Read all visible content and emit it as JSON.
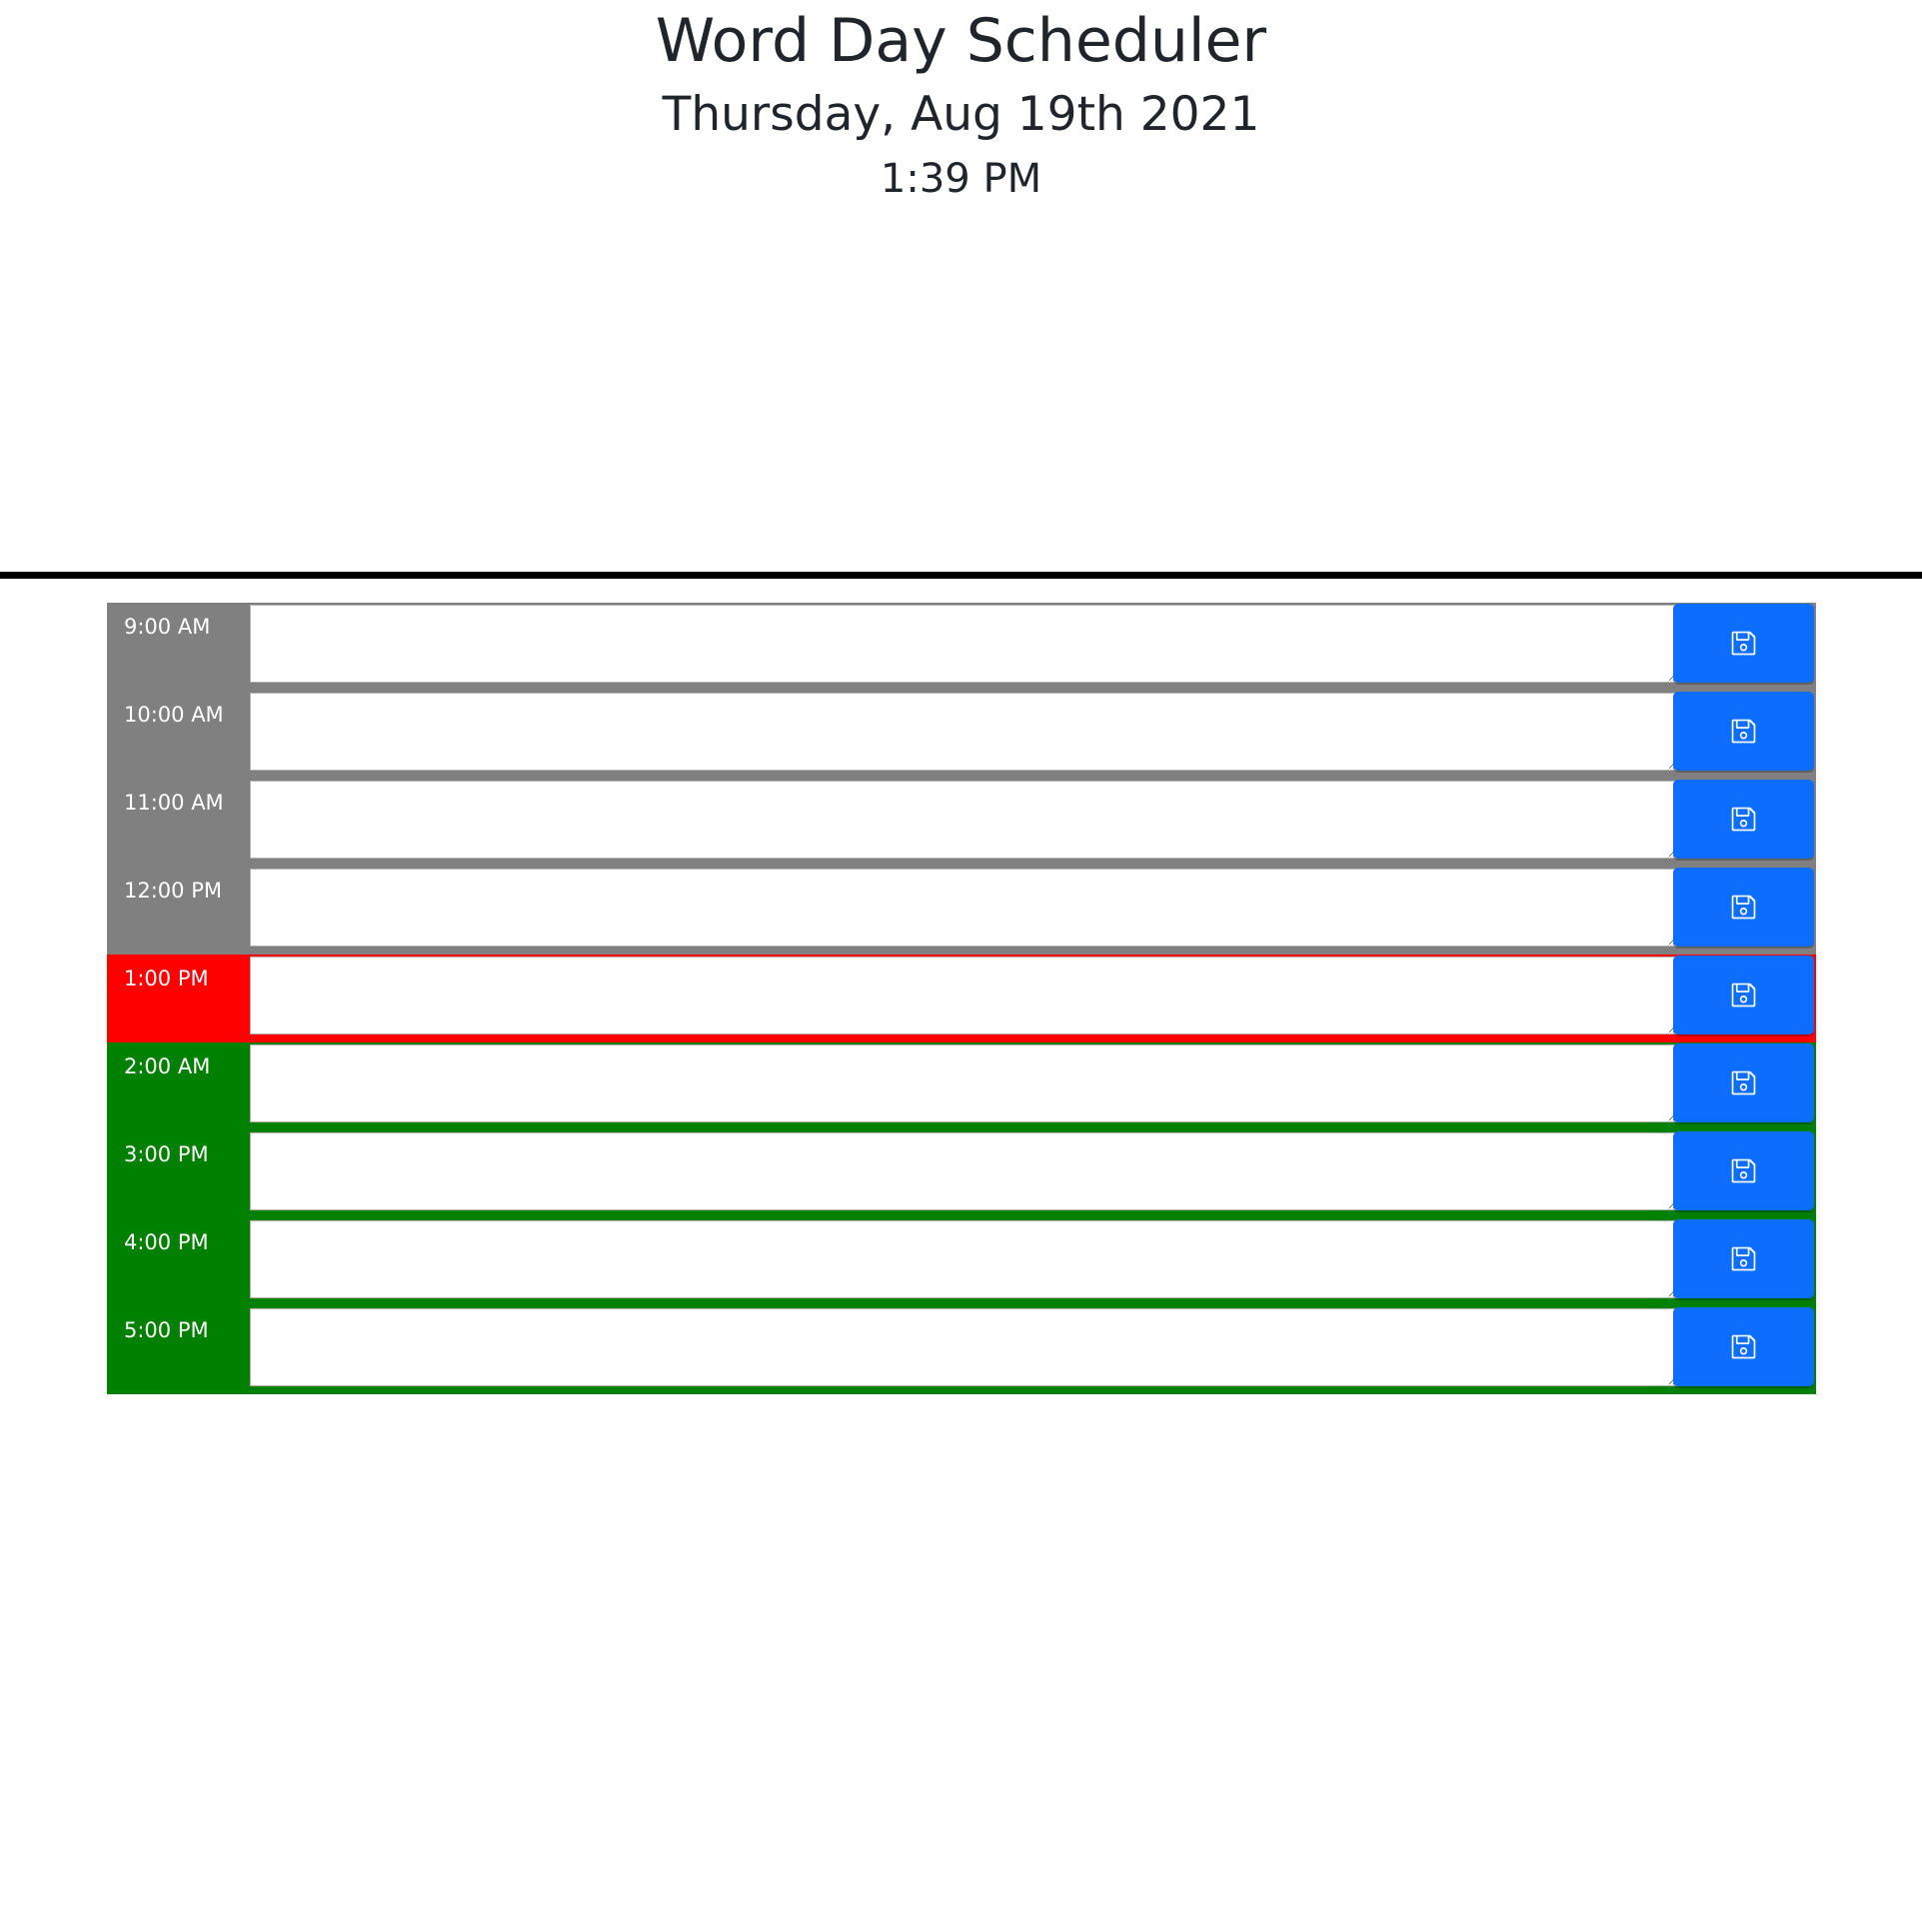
{
  "header": {
    "title": "Word Day Scheduler",
    "date": "Thursday, Aug 19th 2021",
    "time": "1:39 PM"
  },
  "colors": {
    "past": "#808080",
    "present": "#ff0000",
    "future": "#008000",
    "save_button": "#0d6efd",
    "divider": "#000000"
  },
  "rows": [
    {
      "hour": "9:00 AM",
      "state": "past",
      "text": "",
      "icon": "save-icon"
    },
    {
      "hour": "10:00 AM",
      "state": "past",
      "text": "",
      "icon": "save-icon"
    },
    {
      "hour": "11:00 AM",
      "state": "past",
      "text": "",
      "icon": "save-icon"
    },
    {
      "hour": "12:00 PM",
      "state": "past",
      "text": "",
      "icon": "save-icon"
    },
    {
      "hour": "1:00 PM",
      "state": "present",
      "text": "",
      "icon": "save-icon"
    },
    {
      "hour": "2:00 AM",
      "state": "future",
      "text": "",
      "icon": "save-icon"
    },
    {
      "hour": "3:00 PM",
      "state": "future",
      "text": "",
      "icon": "save-icon"
    },
    {
      "hour": "4:00 PM",
      "state": "future",
      "text": "",
      "icon": "save-icon"
    },
    {
      "hour": "5:00 PM",
      "state": "future",
      "text": "",
      "icon": "save-icon"
    }
  ]
}
